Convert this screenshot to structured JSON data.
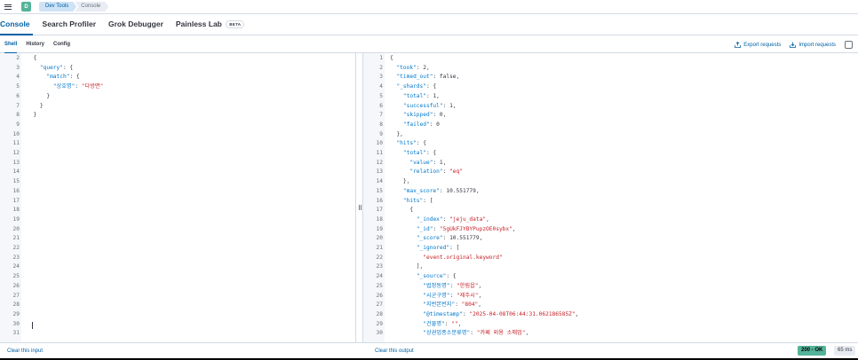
{
  "topbar": {
    "avatar_letter": "D",
    "breadcrumbs": [
      "Dev Tools",
      "Console"
    ]
  },
  "app_tabs": [
    {
      "label": "Console",
      "active": true
    },
    {
      "label": "Search Profiler"
    },
    {
      "label": "Grok Debugger"
    },
    {
      "label": "Painless Lab",
      "badge": "BETA"
    }
  ],
  "sub_tabs": [
    {
      "label": "Shell",
      "active": true
    },
    {
      "label": "History"
    },
    {
      "label": "Config"
    }
  ],
  "actions": {
    "export": "Export requests",
    "import": "Import requests"
  },
  "editor": {
    "lines": [
      {
        "n": "2",
        "t": "  {"
      },
      {
        "n": "3",
        "t": "    \"query\": {"
      },
      {
        "n": "4",
        "t": "      \"match\": {"
      },
      {
        "n": "5",
        "t": "        \"상호명\": \"다방면\""
      },
      {
        "n": "6",
        "t": "      }"
      },
      {
        "n": "7",
        "t": "    }"
      },
      {
        "n": "8",
        "t": "  }"
      },
      {
        "n": "9",
        "t": ""
      },
      {
        "n": "10",
        "t": ""
      },
      {
        "n": "11",
        "t": ""
      },
      {
        "n": "12",
        "t": ""
      },
      {
        "n": "13",
        "t": ""
      },
      {
        "n": "14",
        "t": ""
      },
      {
        "n": "15",
        "t": ""
      },
      {
        "n": "16",
        "t": ""
      },
      {
        "n": "17",
        "t": ""
      },
      {
        "n": "18",
        "t": ""
      },
      {
        "n": "19",
        "t": ""
      },
      {
        "n": "20",
        "t": ""
      },
      {
        "n": "21",
        "t": ""
      },
      {
        "n": "22",
        "t": ""
      },
      {
        "n": "23",
        "t": ""
      },
      {
        "n": "24",
        "t": ""
      },
      {
        "n": "25",
        "t": ""
      },
      {
        "n": "26",
        "t": ""
      },
      {
        "n": "27",
        "t": ""
      },
      {
        "n": "28",
        "t": ""
      },
      {
        "n": "29",
        "t": ""
      },
      {
        "n": "30",
        "t": ""
      },
      {
        "n": "31",
        "t": ""
      }
    ]
  },
  "output": {
    "lines": [
      {
        "n": "1",
        "t": "{"
      },
      {
        "n": "2",
        "t": "  \"took\": 2,"
      },
      {
        "n": "3",
        "t": "  \"timed_out\": false,"
      },
      {
        "n": "4",
        "t": "  \"_shards\": {"
      },
      {
        "n": "5",
        "t": "    \"total\": 1,"
      },
      {
        "n": "6",
        "t": "    \"successful\": 1,"
      },
      {
        "n": "7",
        "t": "    \"skipped\": 0,"
      },
      {
        "n": "8",
        "t": "    \"failed\": 0"
      },
      {
        "n": "9",
        "t": "  },"
      },
      {
        "n": "10",
        "t": "  \"hits\": {"
      },
      {
        "n": "11",
        "t": "    \"total\": {"
      },
      {
        "n": "12",
        "t": "      \"value\": 1,"
      },
      {
        "n": "13",
        "t": "      \"relation\": \"eq\""
      },
      {
        "n": "14",
        "t": "    },"
      },
      {
        "n": "15",
        "t": "    \"max_score\": 10.551779,"
      },
      {
        "n": "16",
        "t": "    \"hits\": ["
      },
      {
        "n": "17",
        "t": "      {"
      },
      {
        "n": "18",
        "t": "        \"_index\": \"jeju_data\","
      },
      {
        "n": "19",
        "t": "        \"_id\": \"5gUkFJYBYPupzOE0sybx\","
      },
      {
        "n": "20",
        "t": "        \"_score\": 10.551779,"
      },
      {
        "n": "21",
        "t": "        \"_ignored\": ["
      },
      {
        "n": "22",
        "t": "          \"event.original.keyword\""
      },
      {
        "n": "23",
        "t": "        ],"
      },
      {
        "n": "24",
        "t": "        \"_source\": {"
      },
      {
        "n": "25",
        "t": "          \"법정동명\": \"한림읍\","
      },
      {
        "n": "26",
        "t": "          \"시군구명\": \"제주시\","
      },
      {
        "n": "27",
        "t": "          \"지번본번지\": \"804\","
      },
      {
        "n": "28",
        "t": "          \"@timestamp\": \"2025-04-08T06:44:31.062186585Z\","
      },
      {
        "n": "29",
        "t": "          \"건물명\": \"\","
      },
      {
        "n": "30",
        "t": "          \"상권업종소분류명\": \"카페 외용 소매업\","
      }
    ]
  },
  "footer": {
    "clear_input": "Clear this input",
    "clear_output": "Clear this output",
    "status": "200 - OK",
    "duration": "65 ms"
  }
}
